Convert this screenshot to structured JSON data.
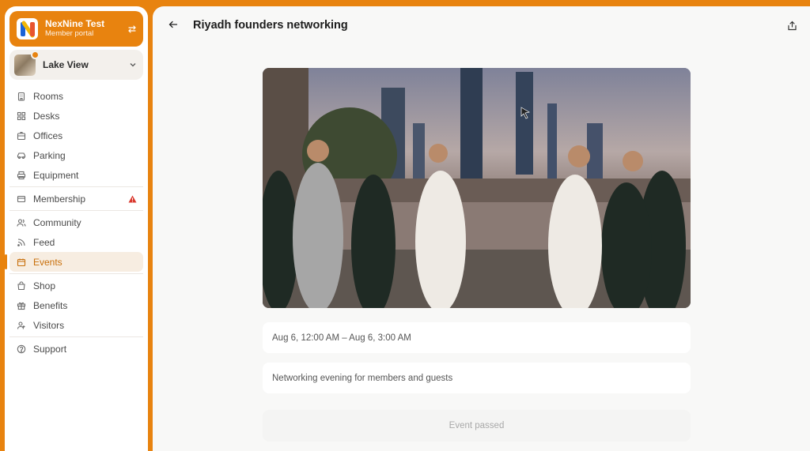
{
  "brand": {
    "name": "NexNine Test",
    "subtitle": "Member portal"
  },
  "location": {
    "name": "Lake View"
  },
  "nav": [
    {
      "label": "Rooms",
      "icon": "building-icon"
    },
    {
      "label": "Desks",
      "icon": "grid-icon"
    },
    {
      "label": "Offices",
      "icon": "offices-icon"
    },
    {
      "label": "Parking",
      "icon": "car-icon"
    },
    {
      "label": "Equipment",
      "icon": "printer-icon"
    },
    {
      "label": "Membership",
      "icon": "card-icon"
    },
    {
      "label": "Community",
      "icon": "users-icon"
    },
    {
      "label": "Feed",
      "icon": "rss-icon"
    },
    {
      "label": "Events",
      "icon": "calendar-icon"
    },
    {
      "label": "Shop",
      "icon": "bag-icon"
    },
    {
      "label": "Benefits",
      "icon": "gift-icon"
    },
    {
      "label": "Visitors",
      "icon": "visitors-icon"
    },
    {
      "label": "Support",
      "icon": "help-icon"
    }
  ],
  "page": {
    "title": "Riyadh founders networking",
    "datetime": "Aug 6, 12:00 AM – Aug 6, 3:00 AM",
    "description": "Networking evening for members and guests",
    "status": "Event passed"
  },
  "colors": {
    "accent": "#e8830f",
    "warning": "#d9362b"
  }
}
